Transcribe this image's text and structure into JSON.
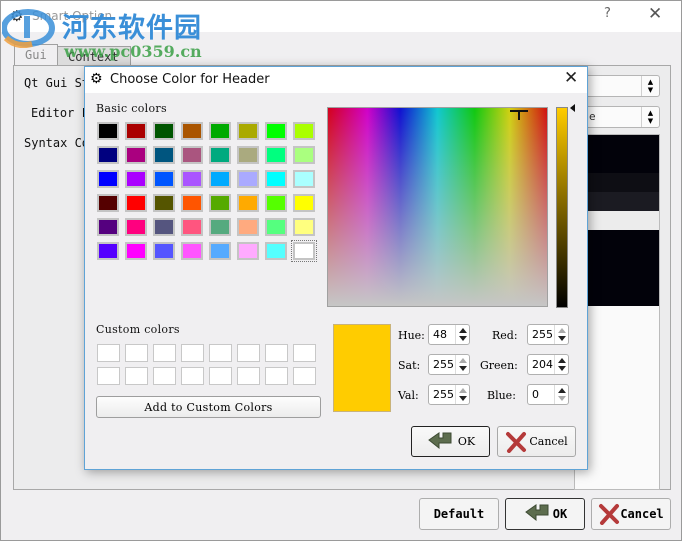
{
  "main_window": {
    "title": "Smart Option",
    "help_label": "?",
    "close_label": "✕",
    "tabs": [
      {
        "label": "Gui",
        "active": true
      },
      {
        "label": "Context",
        "active": false
      }
    ],
    "labels": {
      "qt_gui_style": "Qt Gui St",
      "editor_font": "Editor F",
      "syntax_colors": "Syntax Co"
    },
    "editor_font_value_fragment": "e",
    "buttons": {
      "default": "Default",
      "ok": "OK",
      "cancel": "Cancel"
    }
  },
  "watermark": {
    "text": "河东软件园",
    "url": "www.pc0359.cn"
  },
  "color_dialog": {
    "title": "Choose Color for Header",
    "close_label": "✕",
    "basic_colors_label": "Basic colors",
    "basic_colors": [
      [
        "#000000",
        "#aa0000",
        "#005500",
        "#aa5500",
        "#00aa00",
        "#aaaa00",
        "#00ff00",
        "#aaff00"
      ],
      [
        "#00007f",
        "#aa007f",
        "#00557f",
        "#aa557f",
        "#00aa7f",
        "#aaaa7f",
        "#00ff7f",
        "#aaff7f"
      ],
      [
        "#0000ff",
        "#aa00ff",
        "#0055ff",
        "#aa55ff",
        "#00aaff",
        "#aaaaff",
        "#00ffff",
        "#aaffff"
      ],
      [
        "#550000",
        "#ff0000",
        "#555500",
        "#ff5500",
        "#55aa00",
        "#ffaa00",
        "#55ff00",
        "#ffff00"
      ],
      [
        "#55007f",
        "#ff007f",
        "#55557f",
        "#ff557f",
        "#55aa7f",
        "#ffaa7f",
        "#55ff7f",
        "#ffff7f"
      ],
      [
        "#5500ff",
        "#ff00ff",
        "#5555ff",
        "#ff55ff",
        "#55aaff",
        "#ffaaff",
        "#55ffff",
        "#ffffff"
      ]
    ],
    "selected_basic_color": "#ffffff",
    "custom_colors_label": "Custom colors",
    "custom_colors": [
      "#ffffff",
      "#ffffff",
      "#ffffff",
      "#ffffff",
      "#ffffff",
      "#ffffff",
      "#ffffff",
      "#ffffff",
      "#ffffff",
      "#ffffff",
      "#ffffff",
      "#ffffff",
      "#ffffff",
      "#ffffff",
      "#ffffff",
      "#ffffff"
    ],
    "add_custom_label": "Add to Custom Colors",
    "current_color": "#ffcc00",
    "fields": {
      "hue": {
        "label": "Hue:",
        "value": "48"
      },
      "sat": {
        "label": "Sat:",
        "value": "255"
      },
      "val": {
        "label": "Val:",
        "value": "255"
      },
      "red": {
        "label": "Red:",
        "value": "255"
      },
      "green": {
        "label": "Green:",
        "value": "204"
      },
      "blue": {
        "label": "Blue:",
        "value": "0"
      }
    },
    "ok_label": "OK",
    "cancel_label": "Cancel"
  }
}
